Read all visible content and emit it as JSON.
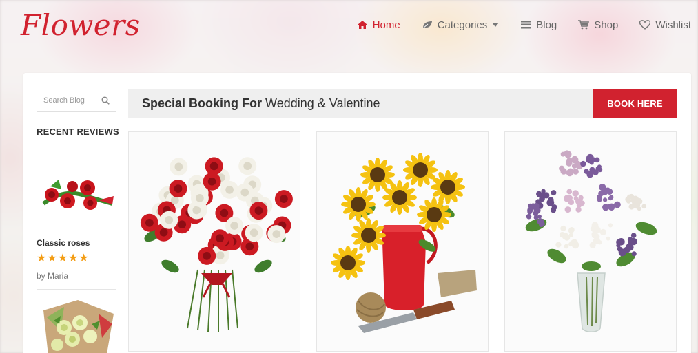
{
  "brand": {
    "logo": "Flowers",
    "accent": "#d1222f"
  },
  "nav": {
    "items": [
      {
        "label": "Home",
        "icon": "home-icon",
        "active": true
      },
      {
        "label": "Categories",
        "icon": "leaf-icon"
      },
      {
        "label": "Blog",
        "icon": "list-icon"
      },
      {
        "label": "Shop",
        "icon": "cart-icon"
      },
      {
        "label": "Wishlist",
        "icon": "heart-icon"
      }
    ]
  },
  "sidebar": {
    "search": {
      "placeholder": "Search Blog"
    },
    "recent_reviews_title": "RECENT REVIEWS",
    "reviews": [
      {
        "name": "Classic roses",
        "rating": 5,
        "author": "by Maria"
      }
    ]
  },
  "banner": {
    "bold": "Special Booking For",
    "text": "Wedding & Valentine",
    "button": "BOOK HERE"
  },
  "products": [
    {
      "name": "rose-bouquet"
    },
    {
      "name": "sunflower-vase"
    },
    {
      "name": "lilac-vase"
    }
  ]
}
